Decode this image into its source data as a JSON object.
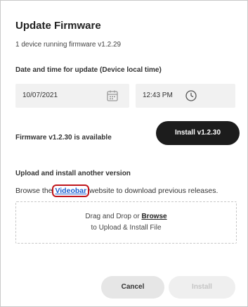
{
  "dialog": {
    "title": "Update Firmware",
    "subtitle": "1 device running firmware v1.2.29"
  },
  "schedule": {
    "label": "Date and time for update (Device local time)",
    "date_value": "10/07/2021",
    "time_value": "12:43 PM",
    "date_icon": "calendar-icon",
    "time_icon": "clock-icon"
  },
  "firmware": {
    "available_text": "Firmware v1.2.30 is available",
    "install_button_label": "Install v1.2.30"
  },
  "upload": {
    "label": "Upload and install another version",
    "browse_prefix": "Browse the ",
    "link_text": "Videobar",
    "browse_suffix": " website to download previous releases.",
    "dropzone_line1_prefix": "Drag and Drop or ",
    "dropzone_browse": "Browse",
    "dropzone_line2": "to Upload & Install File"
  },
  "footer": {
    "cancel_label": "Cancel",
    "install_label": "Install"
  },
  "colors": {
    "primary_button": "#1c1c1c",
    "link": "#1a5fd0",
    "highlight_box": "#c0161c",
    "disabled_button": "#efefef"
  }
}
